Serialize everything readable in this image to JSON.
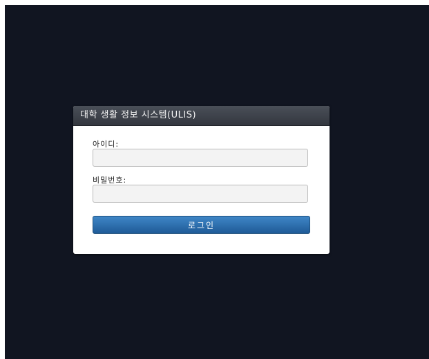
{
  "login_panel": {
    "title": "대학 생활 정보 시스템(ULIS)",
    "id_label": "아이디:",
    "id_value": "",
    "password_label": "비밀번호:",
    "password_value": "",
    "login_button_label": "로그인"
  },
  "colors": {
    "background": "#111521",
    "header": "#3a3e47",
    "button": "#2a6fb0"
  }
}
